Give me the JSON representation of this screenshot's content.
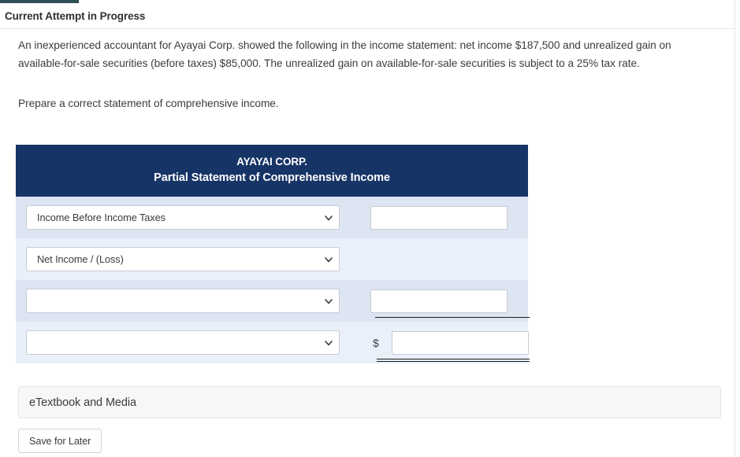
{
  "top_bar": {
    "present": true,
    "color": "#2d4f56"
  },
  "attempt": {
    "title": "Current Attempt in Progress"
  },
  "question": {
    "prompt": "An inexperienced accountant for Ayayai Corp. showed the following in the income statement: net income $187,500 and unrealized gain on available-for-sale securities (before taxes) $85,000. The unrealized gain on available-for-sale securities is subject to a 25% tax rate.",
    "instruction": "Prepare a correct statement of comprehensive income."
  },
  "statement": {
    "company": "AYAYAI CORP.",
    "subtitle": "Partial Statement of Comprehensive Income",
    "header_color": "#173466",
    "row_shade_a": "#dde5f2",
    "row_shade_b": "#eaf0fa",
    "rows": [
      {
        "account": "Income Before Income Taxes",
        "account_placeholder": "",
        "amount": "",
        "amount_placeholder": "",
        "has_amount_input": true,
        "dollar_prefix": "",
        "underline": "none",
        "shade": "a"
      },
      {
        "account": "Net Income / (Loss)",
        "account_placeholder": "",
        "amount": "",
        "amount_placeholder": "",
        "has_amount_input": false,
        "dollar_prefix": "",
        "underline": "none",
        "shade": "b"
      },
      {
        "account": "",
        "account_placeholder": "",
        "amount": "",
        "amount_placeholder": "",
        "has_amount_input": true,
        "dollar_prefix": "",
        "underline": "single",
        "shade": "a"
      },
      {
        "account": "",
        "account_placeholder": "",
        "amount": "",
        "amount_placeholder": "",
        "has_amount_input": true,
        "dollar_prefix": "$",
        "underline": "double",
        "shade": "b"
      }
    ]
  },
  "etextbook": {
    "label": "eTextbook and Media"
  },
  "actions": {
    "save_for_later": "Save for Later"
  }
}
